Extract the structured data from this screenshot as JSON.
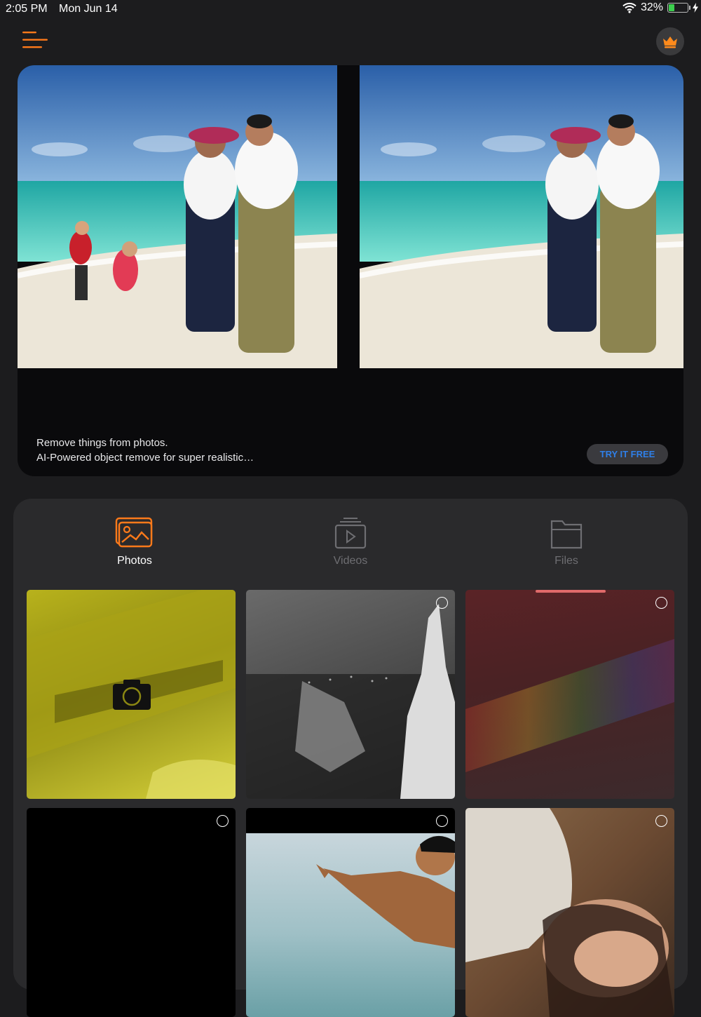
{
  "status_bar": {
    "time": "2:05 PM",
    "date": "Mon Jun 14",
    "battery_percent": "32%",
    "battery_level": 0.32
  },
  "header": {
    "menu_icon": "menu-lines-icon",
    "premium_icon": "crown-icon",
    "accent_color": "#ff7a1a"
  },
  "hero": {
    "line1": "Remove things from photos.",
    "line2": "AI-Powered object remove for super realistic…",
    "button_label": "TRY IT FREE",
    "button_text_color": "#2f7fe8"
  },
  "tabs": [
    {
      "label": "Photos",
      "icon": "photos-icon",
      "active": true
    },
    {
      "label": "Videos",
      "icon": "videos-icon",
      "active": false
    },
    {
      "label": "Files",
      "icon": "folder-icon",
      "active": false
    }
  ],
  "grid": {
    "camera_icon": "camera-icon",
    "selection_icon": "select-circle-icon"
  }
}
